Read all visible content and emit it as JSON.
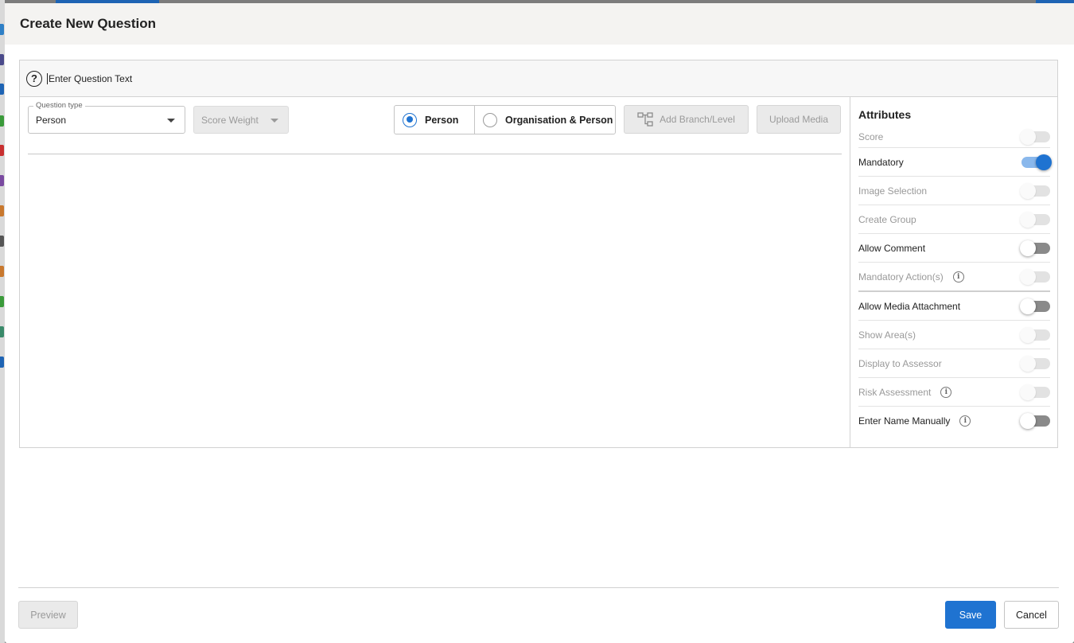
{
  "modal": {
    "title": "Create New Question"
  },
  "question_text": {
    "placeholder": "Enter Question Text"
  },
  "question_type": {
    "legend": "Question type",
    "value": "Person"
  },
  "score_weight": {
    "label": "Score Weight"
  },
  "respondent": {
    "options": [
      {
        "label": "Person",
        "selected": true
      },
      {
        "label": "Organisation & Person",
        "selected": false
      }
    ]
  },
  "toolbar": {
    "add_branch_label": "Add Branch/Level",
    "upload_media_label": "Upload Media"
  },
  "attributes": {
    "title": "Attributes",
    "items": [
      {
        "label": "Score",
        "state": "disabled",
        "info": false
      },
      {
        "label": "Mandatory",
        "state": "on",
        "info": false
      },
      {
        "label": "Image Selection",
        "state": "disabled",
        "info": false
      },
      {
        "label": "Create Group",
        "state": "disabled",
        "info": false
      },
      {
        "label": "Allow Comment",
        "state": "off",
        "info": false
      },
      {
        "label": "Mandatory Action(s)",
        "state": "disabled",
        "info": true
      },
      {
        "label": "Allow Media Attachment",
        "state": "off",
        "info": false
      },
      {
        "label": "Show Area(s)",
        "state": "disabled",
        "info": false
      },
      {
        "label": "Display to Assessor",
        "state": "disabled",
        "info": false
      },
      {
        "label": "Risk Assessment",
        "state": "disabled",
        "info": true
      },
      {
        "label": "Enter Name Manually",
        "state": "off",
        "info": true
      }
    ]
  },
  "footer": {
    "preview_label": "Preview",
    "save_label": "Save",
    "cancel_label": "Cancel"
  },
  "colors": {
    "accent": "#1f73d1",
    "header_bg": "#f4f3f1"
  }
}
